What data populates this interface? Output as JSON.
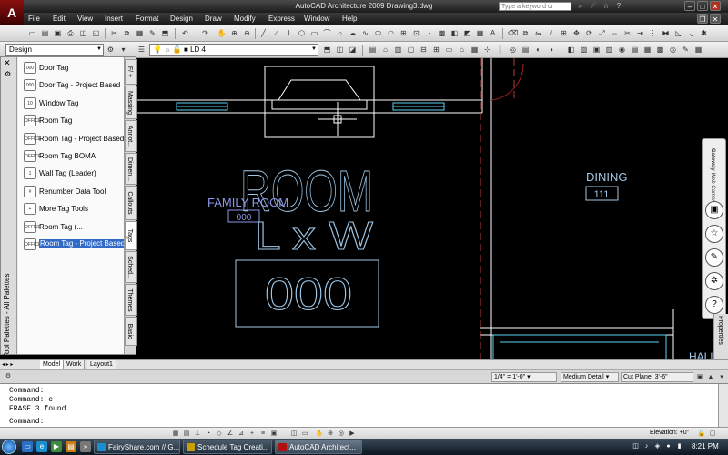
{
  "window": {
    "title": "AutoCAD Architecture 2009  Drawing3.dwg",
    "search_placeholder": "Type a keyword or phrase",
    "logo": "A"
  },
  "menu": [
    "File",
    "Edit",
    "View",
    "Insert",
    "Format",
    "Design",
    "Draw",
    "Modify",
    "Express",
    "Window",
    "Help"
  ],
  "toolbar": {
    "workspace": "Design",
    "layer": "LD 4"
  },
  "palette": {
    "title": "Tool Palettes - All Palettes",
    "items": [
      {
        "label": "Door Tag",
        "icon": "000"
      },
      {
        "label": "Door Tag - Project Based",
        "icon": "000"
      },
      {
        "label": "Window Tag",
        "icon": "10"
      },
      {
        "label": "Room Tag",
        "icon": "OFFICE"
      },
      {
        "label": "Room Tag - Project Based",
        "icon": "OFFICE"
      },
      {
        "label": "Room Tag BOMA",
        "icon": "OFFICE"
      },
      {
        "label": "Wall Tag (Leader)",
        "icon": "1"
      },
      {
        "label": "Renumber Data Tool",
        "icon": "#"
      },
      {
        "label": "More Tag Tools",
        "icon": "+"
      },
      {
        "label": "Room Tag (...",
        "icon": "OFFICE"
      },
      {
        "label": "Room Tag - Project Based",
        "icon": "OFFICE"
      }
    ],
    "selected_index": 10,
    "tabs": [
      "F/ + ",
      "Massing",
      "Annot...",
      "Dimen...",
      "Callouts",
      "Tags",
      "Sched...",
      "Themes",
      "Basic"
    ],
    "active_tab": "Tags"
  },
  "drawing": {
    "room_name": "ROOM",
    "room_dims": "L x W",
    "room_number": "000",
    "family_room_name": "FAMILY ROOM",
    "family_room_number": "000",
    "dining_name": "DINING",
    "dining_number": "111",
    "hall_label": "HALL"
  },
  "navbar": {
    "gateway_label": "Gateway",
    "gateway_sub": "Web Camera",
    "properties_label": "Properties"
  },
  "layout_tabs": [
    "Model",
    "Work",
    "Layout1"
  ],
  "draw_status": {
    "scale": "1/4\" = 1'-0\"",
    "detail": "Medium Detail",
    "cut_plane": "Cut Plane: 3'-6\""
  },
  "command_history": [
    "Command:",
    "Command: e",
    "ERASE 3 found",
    "Command:"
  ],
  "statusbar": {
    "elevation": "Elevation: +0\""
  },
  "taskbar": {
    "buttons": [
      "FairyShare.com // G...",
      "Schedule Tag Creati...",
      "AutoCAD Architect..."
    ],
    "active_index": 2,
    "clock": "8:21 PM"
  },
  "colors": {
    "drawing_bg": "#000000",
    "room_text": "#a0c8e8",
    "family_text": "#8c96e6",
    "wall_color": "#ffffff",
    "window_color": "#5ad2f0",
    "grid_red": "#b43c3c",
    "palette_selected": "#3169c6"
  }
}
